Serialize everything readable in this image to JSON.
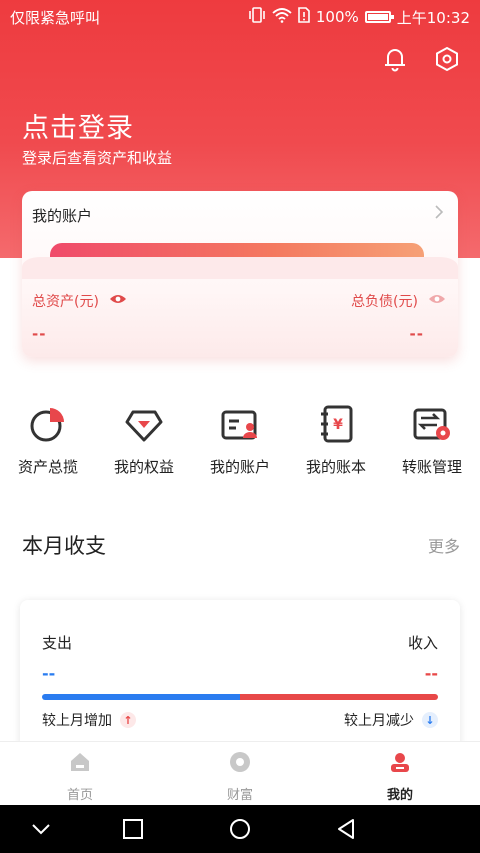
{
  "status_bar": {
    "left_text": "仅限紧急呼叫",
    "battery": "100%",
    "time": "上午10:32"
  },
  "header": {
    "login_title": "点击登录",
    "login_subtitle": "登录后查看资产和收益"
  },
  "account_card": {
    "title": "我的账户",
    "total_assets_label": "总资产(元)",
    "total_assets_value": "--",
    "total_debt_label": "总负债(元)",
    "total_debt_value": "--"
  },
  "quick_actions": [
    {
      "label": "资产总揽",
      "icon": "pie-chart-icon"
    },
    {
      "label": "我的权益",
      "icon": "gem-icon"
    },
    {
      "label": "我的账户",
      "icon": "account-card-icon"
    },
    {
      "label": "我的账本",
      "icon": "ledger-icon"
    },
    {
      "label": "转账管理",
      "icon": "transfer-icon"
    }
  ],
  "monthly": {
    "title": "本月收支",
    "more": "更多",
    "expense_label": "支出",
    "income_label": "收入",
    "expense_value": "--",
    "income_value": "--",
    "compare_left": "较上月增加",
    "compare_right": "较上月减少",
    "expense_share": 0.5
  },
  "bottom_nav": [
    {
      "label": "首页",
      "icon": "home-icon",
      "active": false
    },
    {
      "label": "财富",
      "icon": "wealth-icon",
      "active": false
    },
    {
      "label": "我的",
      "icon": "profile-icon",
      "active": true
    }
  ],
  "colors": {
    "brand_red": "#ee3b3f",
    "expense_blue": "#2a7cf0",
    "income_red": "#e84848"
  }
}
